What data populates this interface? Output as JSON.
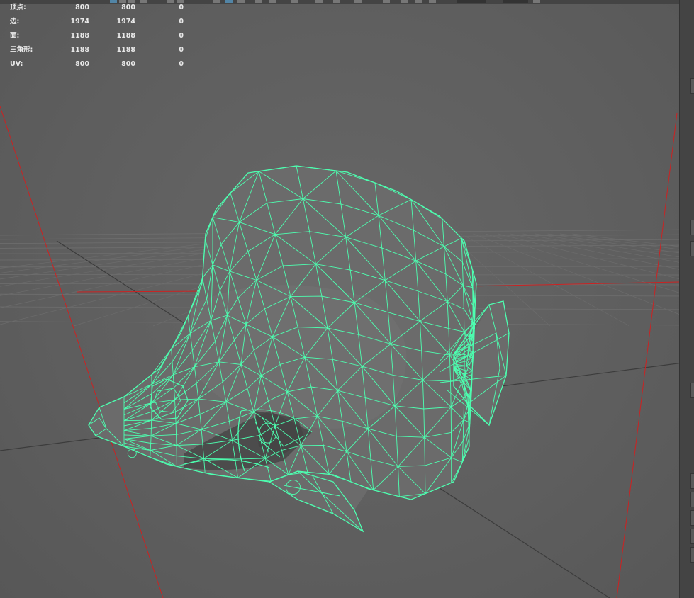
{
  "hud": {
    "rows": [
      {
        "label": "顶点:",
        "v1": "800",
        "v2": "800",
        "v3": "0"
      },
      {
        "label": "边:",
        "v1": "1974",
        "v2": "1974",
        "v3": "0"
      },
      {
        "label": "面:",
        "v1": "1188",
        "v2": "1188",
        "v3": "0"
      },
      {
        "label": "三角形:",
        "v1": "1188",
        "v2": "1188",
        "v3": "0"
      },
      {
        "label": "UV:",
        "v1": "800",
        "v2": "800",
        "v3": "0"
      }
    ]
  },
  "colors": {
    "background": "#5d5d5d",
    "wireframe": "#4dffb0",
    "axis": "#cc2222",
    "grid": "#6e6e6e",
    "grid_major": "#3a3a3a"
  }
}
